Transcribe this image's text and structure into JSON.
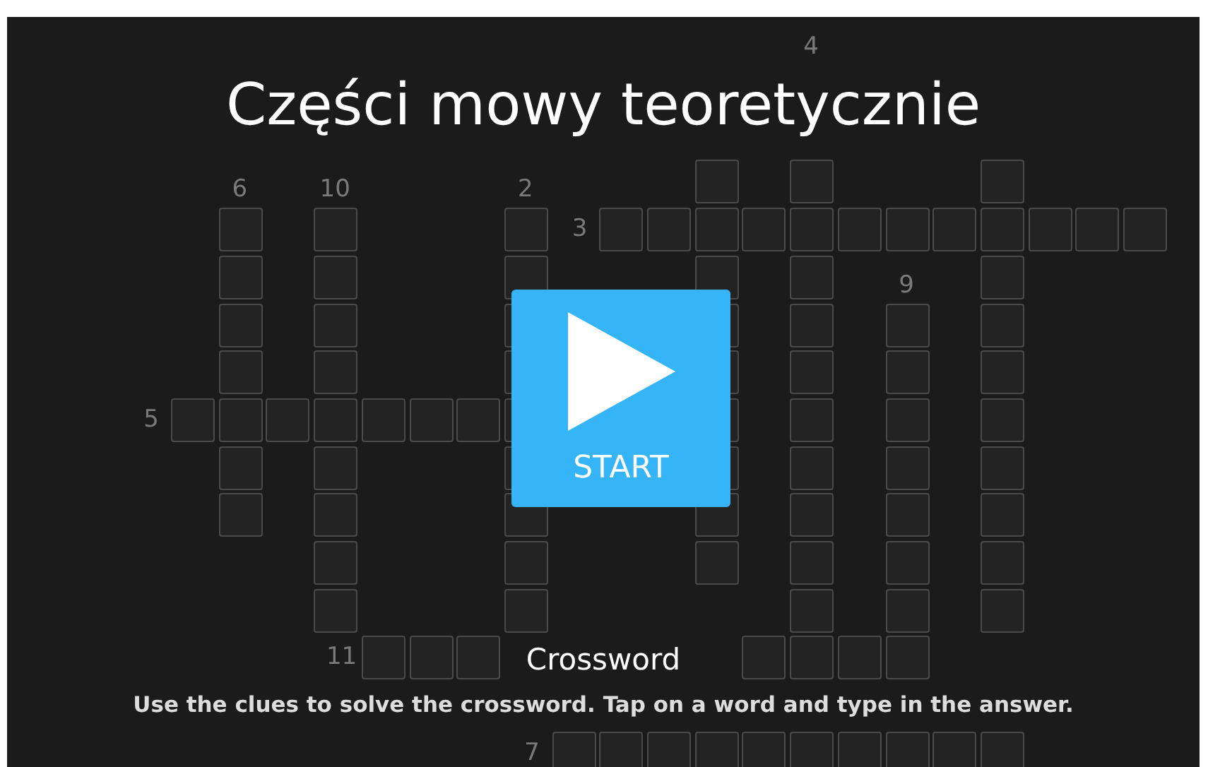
{
  "title": "Części mowy teoretycznie",
  "crossword": {
    "words": [
      {
        "kind": "down"
      },
      {
        "kind": "down",
        "number": "2"
      },
      {
        "kind": "across",
        "number": "3"
      },
      {
        "kind": "down",
        "number": "4"
      },
      {
        "kind": "across",
        "number": "5"
      },
      {
        "kind": "down",
        "number": "6"
      },
      {
        "kind": "across",
        "number": "7"
      },
      {
        "kind": "down"
      },
      {
        "kind": "down",
        "number": "9"
      },
      {
        "kind": "down",
        "number": "10"
      },
      {
        "kind": "across",
        "number": "11"
      }
    ]
  },
  "start_button": {
    "label": "START"
  },
  "activity": {
    "name": "Crossword",
    "instructions": "Use the clues to solve the crossword. Tap on a word and type in the answer."
  }
}
